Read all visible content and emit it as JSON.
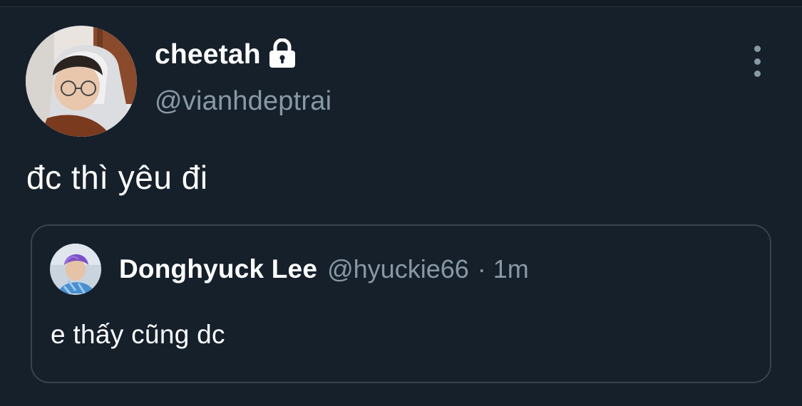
{
  "tweet": {
    "author": {
      "name": "cheetah",
      "handle": "@vianhdeptrai",
      "protected_icon": "lock-icon",
      "avatar": "profile-photo"
    },
    "more_icon": "more-vertical-icon",
    "text": "đc thì yêu đi",
    "quoted_tweet": {
      "author": {
        "name": "Donghyuck Lee",
        "handle": "@hyuckie66",
        "avatar": "profile-photo"
      },
      "separator": "·",
      "time": "1m",
      "text": "e thấy cũng dc"
    }
  },
  "colors": {
    "background": "#15202b",
    "primary_text": "#ffffff",
    "secondary_text": "#8899a6",
    "border": "#38444d"
  }
}
